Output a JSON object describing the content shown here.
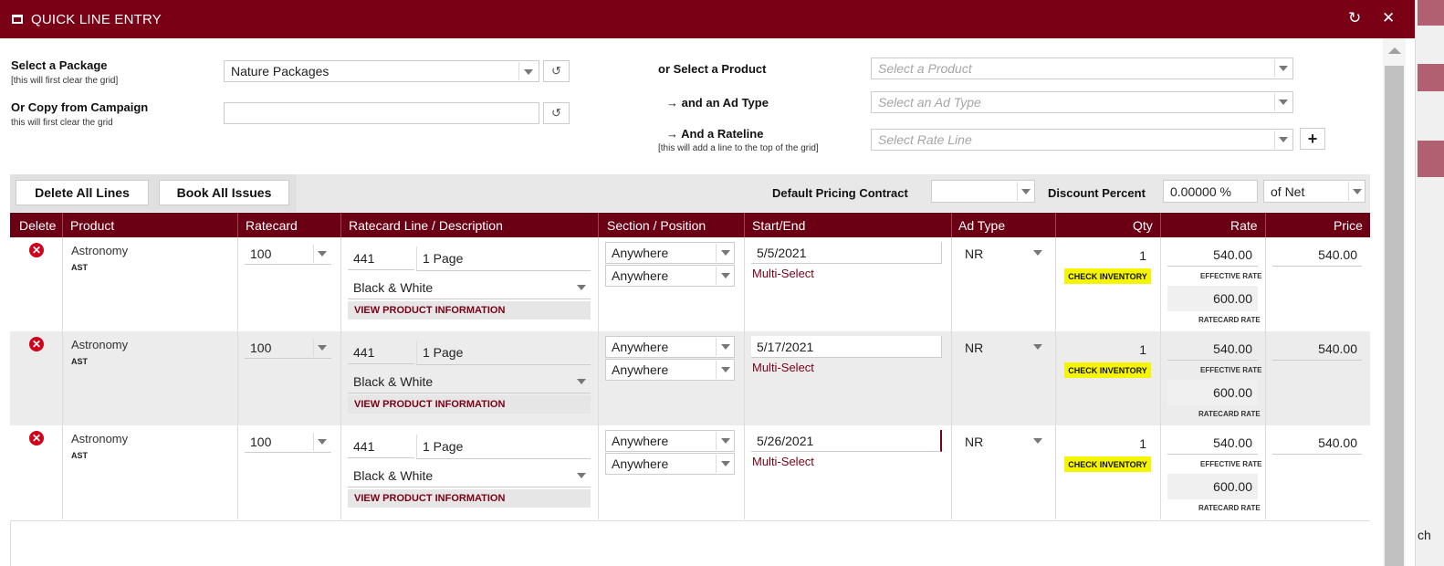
{
  "window": {
    "title": "QUICK LINE ENTRY",
    "refresh_icon": "refresh-icon",
    "close_icon": "close-icon"
  },
  "form": {
    "package": {
      "label": "Select a Package",
      "hint": "[this will first clear the grid]",
      "value": "Nature Packages"
    },
    "campaign": {
      "label": "Or Copy from Campaign",
      "hint": "this will first clear the grid",
      "value": ""
    },
    "product": {
      "label": "or Select a Product",
      "placeholder": "Select a Product"
    },
    "adtype": {
      "label": "→ and an Ad Type",
      "placeholder": "Select an Ad Type"
    },
    "rateline": {
      "label": "→ And a Rateline",
      "hint": "[this will add a line to the top of the grid]",
      "placeholder": "Select Rate Line",
      "add_label": "+"
    }
  },
  "toolbar": {
    "delete_all": "Delete All Lines",
    "book_all": "Book All Issues",
    "pricing_label": "Default Pricing Contract",
    "pricing_value": "",
    "discount_label": "Discount Percent",
    "discount_value": "0.00000 %",
    "of_net": "of Net"
  },
  "columns": [
    "Delete",
    "Product",
    "Ratecard",
    "Ratecard Line / Description",
    "Section / Position",
    "Start/End",
    "Ad Type",
    "Qty",
    "Rate",
    "Price"
  ],
  "rows": [
    {
      "product": "Astronomy",
      "code": "AST",
      "ratecard": "100",
      "line_no": "441",
      "line_desc": "1 Page",
      "color": "Black & White",
      "view_info": "VIEW PRODUCT INFORMATION",
      "section": "Anywhere",
      "position": "Anywhere",
      "start": "5/5/2021",
      "multi": "Multi-Select",
      "adtype": "NR",
      "qty": "1",
      "check": "CHECK INVENTORY",
      "eff_rate": "540.00",
      "eff_label": "EFFECTIVE RATE",
      "card_rate": "600.00",
      "card_label": "RATECARD RATE",
      "price": "540.00"
    },
    {
      "product": "Astronomy",
      "code": "AST",
      "ratecard": "100",
      "line_no": "441",
      "line_desc": "1 Page",
      "color": "Black & White",
      "view_info": "VIEW PRODUCT INFORMATION",
      "section": "Anywhere",
      "position": "Anywhere",
      "start": "5/17/2021",
      "multi": "Multi-Select",
      "adtype": "NR",
      "qty": "1",
      "check": "CHECK INVENTORY",
      "eff_rate": "540.00",
      "eff_label": "EFFECTIVE RATE",
      "card_rate": "600.00",
      "card_label": "RATECARD RATE",
      "price": "540.00"
    },
    {
      "product": "Astronomy",
      "code": "AST",
      "ratecard": "100",
      "line_no": "441",
      "line_desc": "1 Page",
      "color": "Black & White",
      "view_info": "VIEW PRODUCT INFORMATION",
      "section": "Anywhere",
      "position": "Anywhere",
      "start": "5/26/2021",
      "multi": "Multi-Select",
      "adtype": "NR",
      "qty": "1",
      "check": "CHECK INVENTORY",
      "eff_rate": "540.00",
      "eff_label": "EFFECTIVE RATE",
      "card_rate": "600.00",
      "card_label": "RATECARD RATE",
      "price": "540.00"
    }
  ],
  "behind": {
    "partial_text": "ch"
  },
  "colors": {
    "brand": "#7a0016",
    "header": "#6b0015",
    "highlight": "#f5f500",
    "delete": "#d0021b"
  }
}
